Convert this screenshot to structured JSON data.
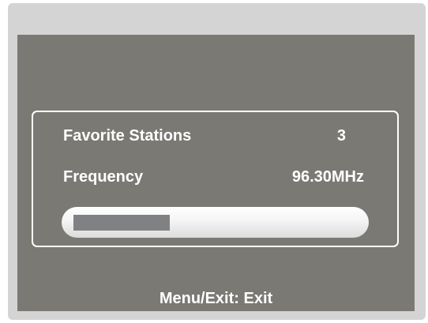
{
  "favorite_stations": {
    "label": "Favorite Stations",
    "value": "3"
  },
  "frequency": {
    "label": "Frequency",
    "value": "96.30MHz"
  },
  "signal_bar": {
    "level_fraction": 0.34
  },
  "footer": {
    "hint": "Menu/Exit: Exit"
  },
  "colors": {
    "screen_background": "#7b7974",
    "frame": "#d4d4d4",
    "text": "#ffffff",
    "bar_fill": "#7f8183"
  }
}
